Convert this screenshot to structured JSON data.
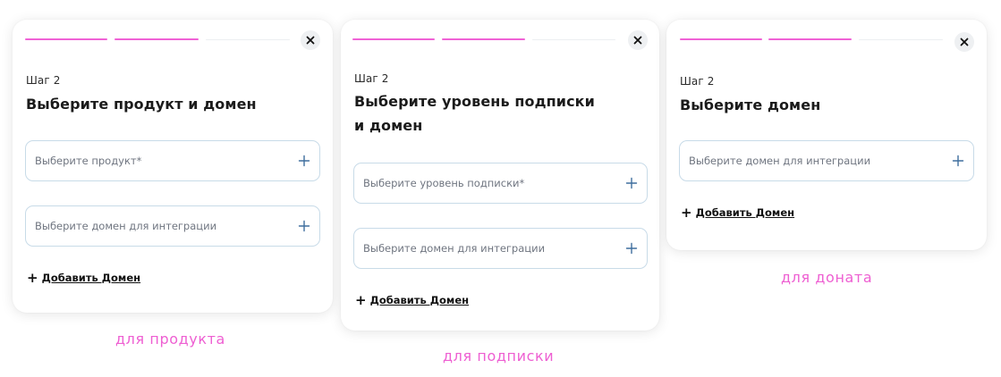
{
  "colors": {
    "accent": "#f062d6",
    "caption": "#ee5fd2",
    "field_border": "#c8dbe8",
    "plus_icon": "#3f6e9e"
  },
  "cards": [
    {
      "step": "Шаг 2",
      "title_lines": [
        "Выберите продукт и домен"
      ],
      "fields": [
        {
          "placeholder": "Выберите продукт*",
          "icon": "plus-icon"
        },
        {
          "placeholder": "Выберите домен для интеграции",
          "icon": "plus-icon"
        }
      ],
      "add_domain_label": "Добавить Домен",
      "caption": "для продукта"
    },
    {
      "step": "Шаг 2",
      "title_lines": [
        "Выберите уровень подписки",
        "и домен"
      ],
      "fields": [
        {
          "placeholder": "Выберите уровень подписки*",
          "icon": "plus-icon"
        },
        {
          "placeholder": "Выберите домен для интеграции",
          "icon": "plus-icon"
        }
      ],
      "add_domain_label": "Добавить Домен",
      "caption": "для подписки"
    },
    {
      "step": "Шаг 2",
      "title_lines": [
        "Выберите домен"
      ],
      "fields": [
        {
          "placeholder": "Выберите домен для интеграции",
          "icon": "plus-icon"
        }
      ],
      "add_domain_label": "Добавить Домен",
      "caption": "для доната"
    }
  ],
  "progress": {
    "total_steps": 3,
    "current_step": 2
  },
  "icons": {
    "close": "close-icon",
    "add": "plus-icon"
  }
}
